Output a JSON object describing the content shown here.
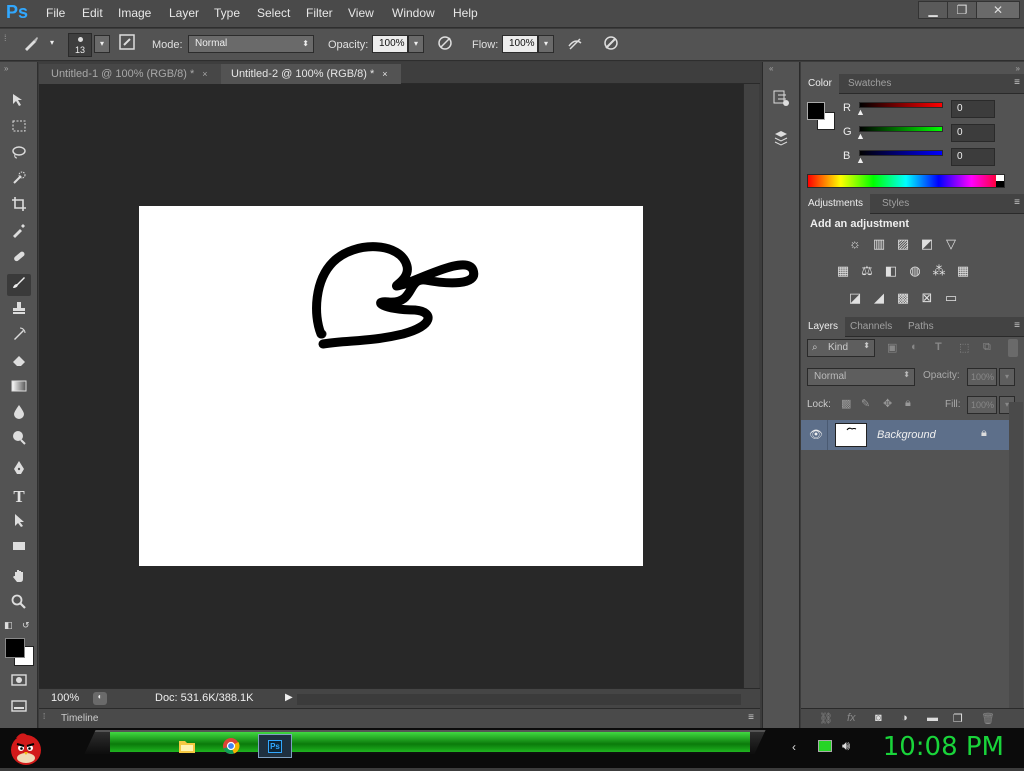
{
  "app": {
    "logo": "Ps"
  },
  "menu": [
    "File",
    "Edit",
    "Image",
    "Layer",
    "Type",
    "Select",
    "Filter",
    "View",
    "Window",
    "Help"
  ],
  "window_controls": {
    "minimize": "▁",
    "restore": "❐",
    "close": "✕"
  },
  "options_bar": {
    "brush_size": "13",
    "mode_label": "Mode:",
    "mode_value": "Normal",
    "opacity_label": "Opacity:",
    "opacity_value": "100%",
    "flow_label": "Flow:",
    "flow_value": "100%"
  },
  "tabs": [
    {
      "label": "Untitled-1 @ 100% (RGB/8) *",
      "close": "×"
    },
    {
      "label": "Untitled-2 @ 100% (RGB/8) *",
      "close": "×"
    }
  ],
  "status": {
    "zoom": "100%",
    "doc": "Doc: 531.6K/388.1K"
  },
  "timeline": {
    "label": "Timeline"
  },
  "color_panel": {
    "tabs": [
      "Color",
      "Swatches"
    ],
    "r_label": "R",
    "r_value": "0",
    "g_label": "G",
    "g_value": "0",
    "b_label": "B",
    "b_value": "0"
  },
  "adjustments_panel": {
    "tabs": [
      "Adjustments",
      "Styles"
    ],
    "heading": "Add an adjustment"
  },
  "layers_panel": {
    "tabs": [
      "Layers",
      "Channels",
      "Paths"
    ],
    "kind": "Kind",
    "blend_mode": "Normal",
    "opacity_label": "Opacity:",
    "opacity_value": "100%",
    "lock_label": "Lock:",
    "fill_label": "Fill:",
    "fill_value": "100%",
    "layer_name": "Background"
  },
  "taskbar": {
    "clock": "10:08 PM",
    "ps_label": "Ps"
  },
  "colors": {
    "accent": "#31a8ff",
    "layer_selected": "#5d6f8a",
    "clock_green": "#19d43a",
    "taskbar_green": "#2bcf2b"
  }
}
